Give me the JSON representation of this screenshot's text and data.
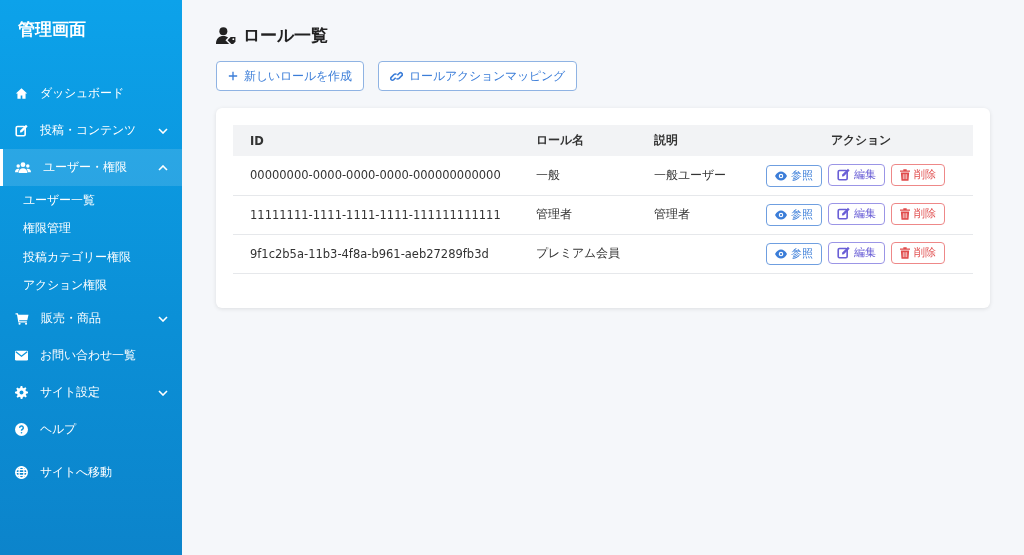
{
  "sidebar": {
    "title": "管理画面",
    "items": [
      {
        "label": "ダッシュボード",
        "kind": "home",
        "selected": false
      },
      {
        "label": "投稿・コンテンツ",
        "kind": "edit",
        "selected": false,
        "expanded": false
      },
      {
        "label": "ユーザー・権限",
        "kind": "users",
        "selected": true,
        "expanded": true,
        "children": [
          {
            "label": "ユーザー一覧",
            "selected": false
          },
          {
            "label": "権限管理",
            "selected": false
          },
          {
            "label": "投稿カテゴリー権限",
            "selected": false
          },
          {
            "label": "アクション権限",
            "selected": false
          }
        ]
      },
      {
        "label": "販売・商品",
        "kind": "cart",
        "selected": false,
        "expanded": false
      },
      {
        "label": "お問い合わせ一覧",
        "kind": "mail",
        "selected": false
      },
      {
        "label": "サイト設定",
        "kind": "gear",
        "selected": false,
        "expanded": false
      },
      {
        "label": "ヘルプ",
        "kind": "help",
        "selected": false
      },
      {
        "label": "サイトへ移動",
        "kind": "globe",
        "selected": false
      }
    ]
  },
  "page": {
    "title": "ロール一覧",
    "buttons": [
      {
        "label": "新しいロールを作成",
        "kind": "plus"
      },
      {
        "label": "ロールアクションマッピング",
        "kind": "link"
      }
    ]
  },
  "table": {
    "columns": [
      "ID",
      "ロール名",
      "説明",
      "アクション"
    ],
    "rows": [
      {
        "id": "00000000-0000-0000-0000-000000000000",
        "name": "一般",
        "description": "一般ユーザー",
        "actions": [
          {
            "label": "参照",
            "kind": "view"
          },
          {
            "label": "編集",
            "kind": "edit"
          },
          {
            "label": "削除",
            "kind": "delete"
          }
        ]
      },
      {
        "id": "11111111-1111-1111-1111-111111111111",
        "name": "管理者",
        "description": "管理者",
        "actions": [
          {
            "label": "参照",
            "kind": "view"
          },
          {
            "label": "編集",
            "kind": "edit"
          },
          {
            "label": "削除",
            "kind": "delete"
          }
        ]
      },
      {
        "id": "9f1c2b5a-11b3-4f8a-b961-aeb27289fb3d",
        "name": "プレミアム会員",
        "actions": [
          {
            "label": "参照",
            "kind": "view"
          },
          {
            "label": "編集",
            "kind": "edit"
          },
          {
            "label": "削除",
            "kind": "delete"
          }
        ]
      }
    ]
  }
}
